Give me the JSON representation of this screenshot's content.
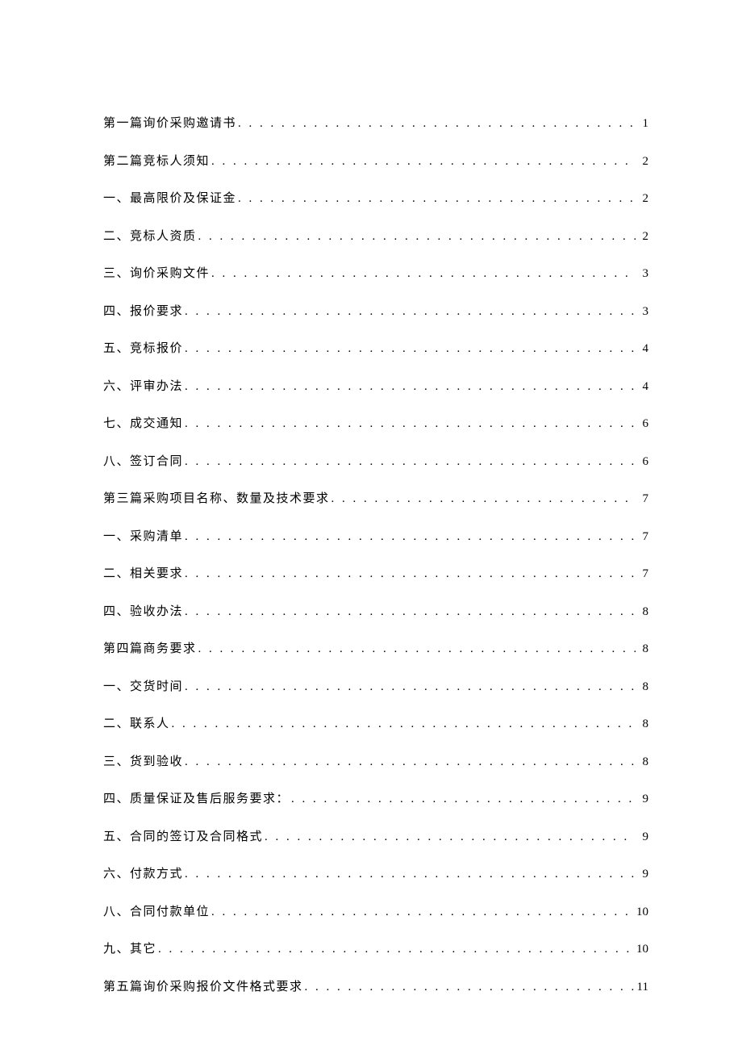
{
  "toc": {
    "entries": [
      {
        "label": "第一篇询价采购邀请书",
        "page": "1"
      },
      {
        "label": "第二篇竞标人须知",
        "page": "2"
      },
      {
        "label": "一、最高限价及保证金",
        "page": "2"
      },
      {
        "label": "二、竞标人资质",
        "page": "2"
      },
      {
        "label": "三、询价采购文件",
        "page": "3"
      },
      {
        "label": "四、报价要求",
        "page": "3"
      },
      {
        "label": "五、竞标报价",
        "page": "4"
      },
      {
        "label": "六、评审办法",
        "page": "4"
      },
      {
        "label": "七、成交通知",
        "page": "6"
      },
      {
        "label": "八、签订合同",
        "page": "6"
      },
      {
        "label": "第三篇采购项目名称、数量及技术要求",
        "page": "7"
      },
      {
        "label": "一、采购清单",
        "page": "7"
      },
      {
        "label": "二、相关要求",
        "page": "7"
      },
      {
        "label": "四、验收办法",
        "page": "8"
      },
      {
        "label": "第四篇商务要求",
        "page": "8"
      },
      {
        "label": "一、交货时间",
        "page": "8"
      },
      {
        "label": "二、联系人",
        "page": "8"
      },
      {
        "label": "三、货到验收",
        "page": "8"
      },
      {
        "label": "四、质量保证及售后服务要求：",
        "page": "9"
      },
      {
        "label": "五、合同的签订及合同格式",
        "page": "9"
      },
      {
        "label": "六、付款方式",
        "page": "9"
      },
      {
        "label": "八、合同付款单位",
        "page": "10"
      },
      {
        "label": "九、其它",
        "page": "10"
      },
      {
        "label": "第五篇询价采购报价文件格式要求",
        "page": "11"
      }
    ]
  }
}
